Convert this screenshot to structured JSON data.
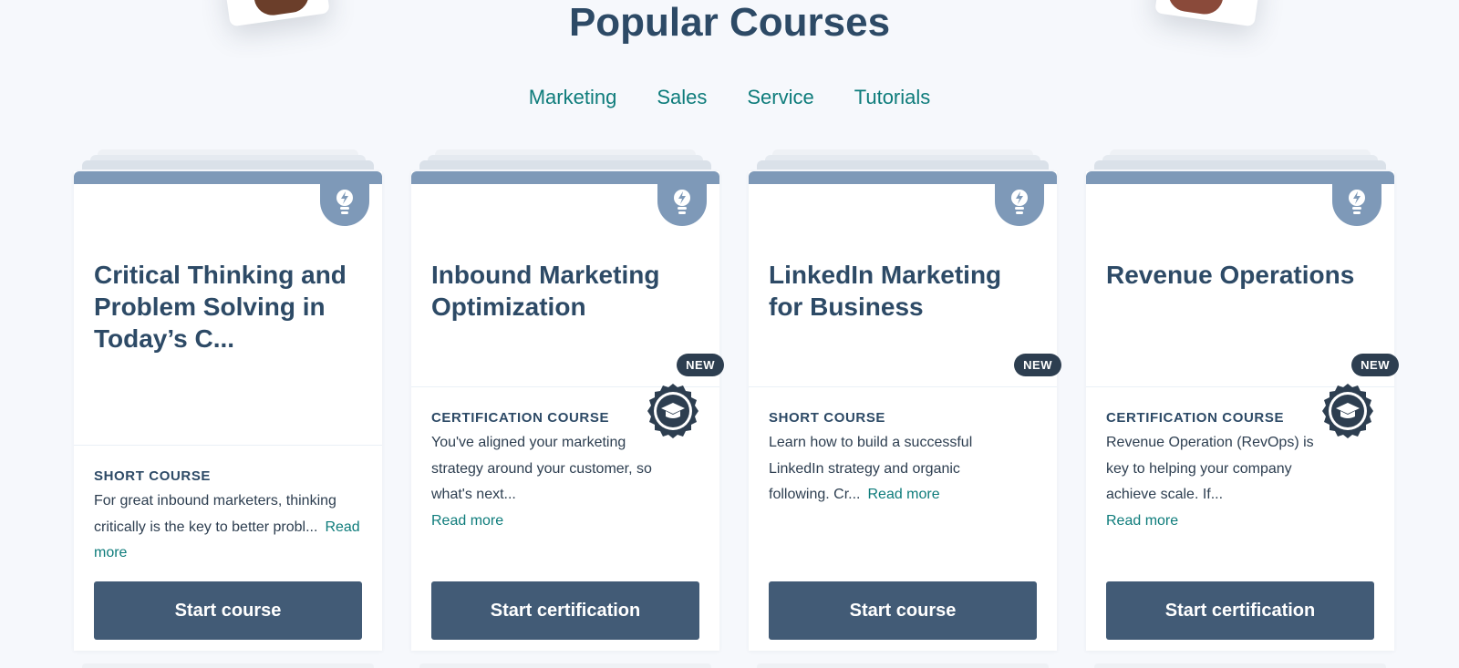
{
  "page": {
    "title": "Popular Courses",
    "tabs": [
      "Marketing",
      "Sales",
      "Service",
      "Tutorials"
    ]
  },
  "colors": {
    "background": "#f6f8fc",
    "heading": "#2d4a66",
    "teal_link": "#0e7c7b",
    "card_accent": "#7e99b8",
    "button": "#425b76",
    "new_badge": "#2d3e50"
  },
  "cards": [
    {
      "title": "Critical Thinking and Problem Solving in Today’s C...",
      "type": "SHORT COURSE",
      "description": "For great inbound marketers, thinking critically is the key to better probl...",
      "read_more": "Read more",
      "button": "Start course",
      "icon": "lightbulb-icon"
    },
    {
      "title": "Inbound Marketing Optimization",
      "badge": "NEW",
      "type": "CERTIFICATION COURSE",
      "description": "You've aligned your marketing strategy around your customer, so what's next...",
      "read_more": "Read more",
      "button": "Start certification",
      "icon": "lightbulb-icon",
      "seal": "graduation-cap-seal-icon"
    },
    {
      "title": "LinkedIn Marketing for Business",
      "badge": "NEW",
      "type": "SHORT COURSE",
      "description": "Learn how to build a successful LinkedIn strategy and organic following. Cr...",
      "read_more": "Read more",
      "button": "Start course",
      "icon": "lightbulb-icon"
    },
    {
      "title": "Revenue Operations",
      "badge": "NEW",
      "type": "CERTIFICATION COURSE",
      "description": "Revenue Operation (RevOps) is key to helping your company achieve scale. If...",
      "read_more": "Read more",
      "button": "Start certification",
      "icon": "lightbulb-icon",
      "seal": "graduation-cap-seal-icon"
    }
  ]
}
